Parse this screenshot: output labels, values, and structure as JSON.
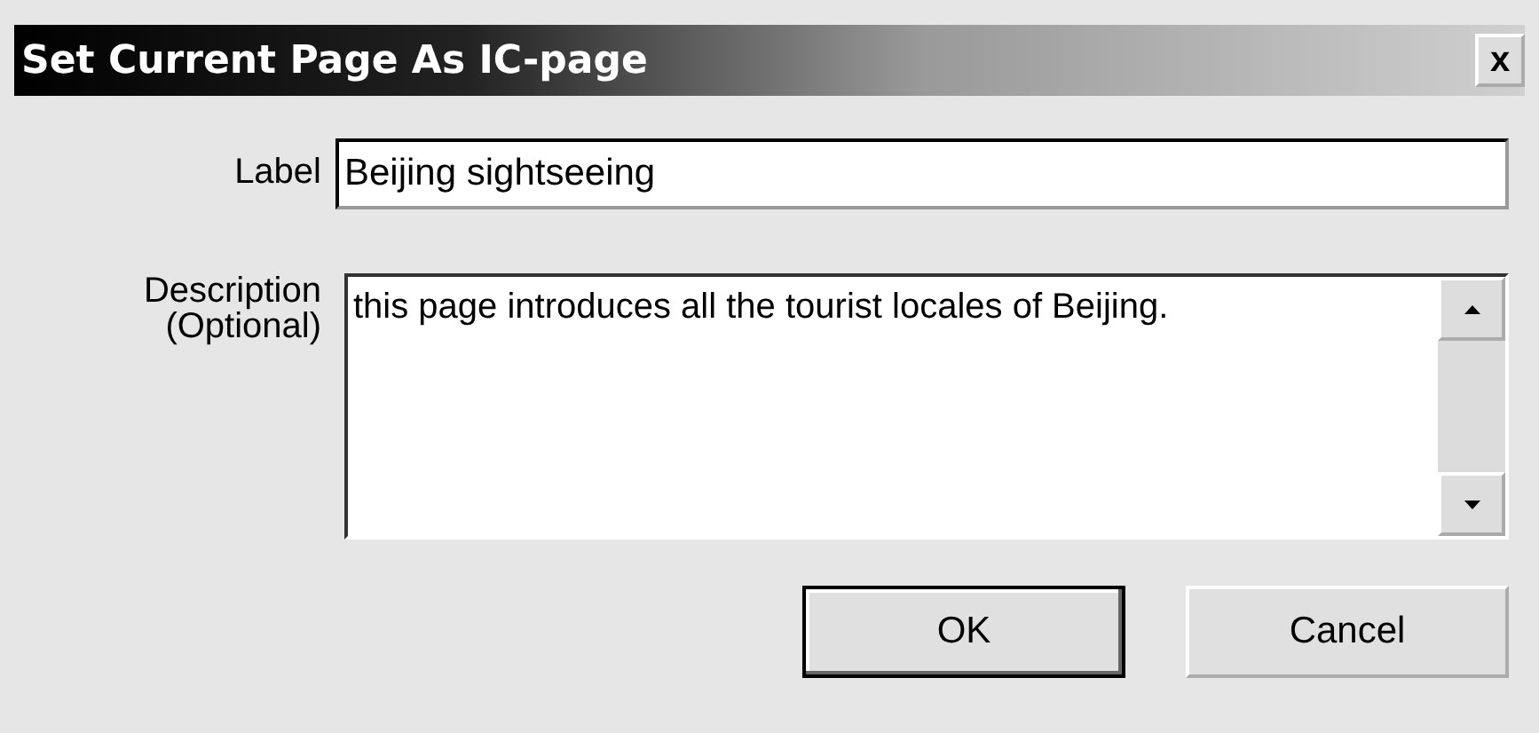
{
  "window": {
    "title": "Set Current Page As IC-page",
    "close": "x"
  },
  "fields": [
    {
      "label": "Label",
      "value": "Beijing sightseeing",
      "kind": "text"
    },
    {
      "label": "Description\n(Optional)",
      "value": "this page introduces all the tourist locales of Beijing.",
      "kind": "multiline"
    }
  ],
  "buttons": [
    {
      "label": "OK",
      "default": true
    },
    {
      "label": "Cancel",
      "default": false
    }
  ]
}
